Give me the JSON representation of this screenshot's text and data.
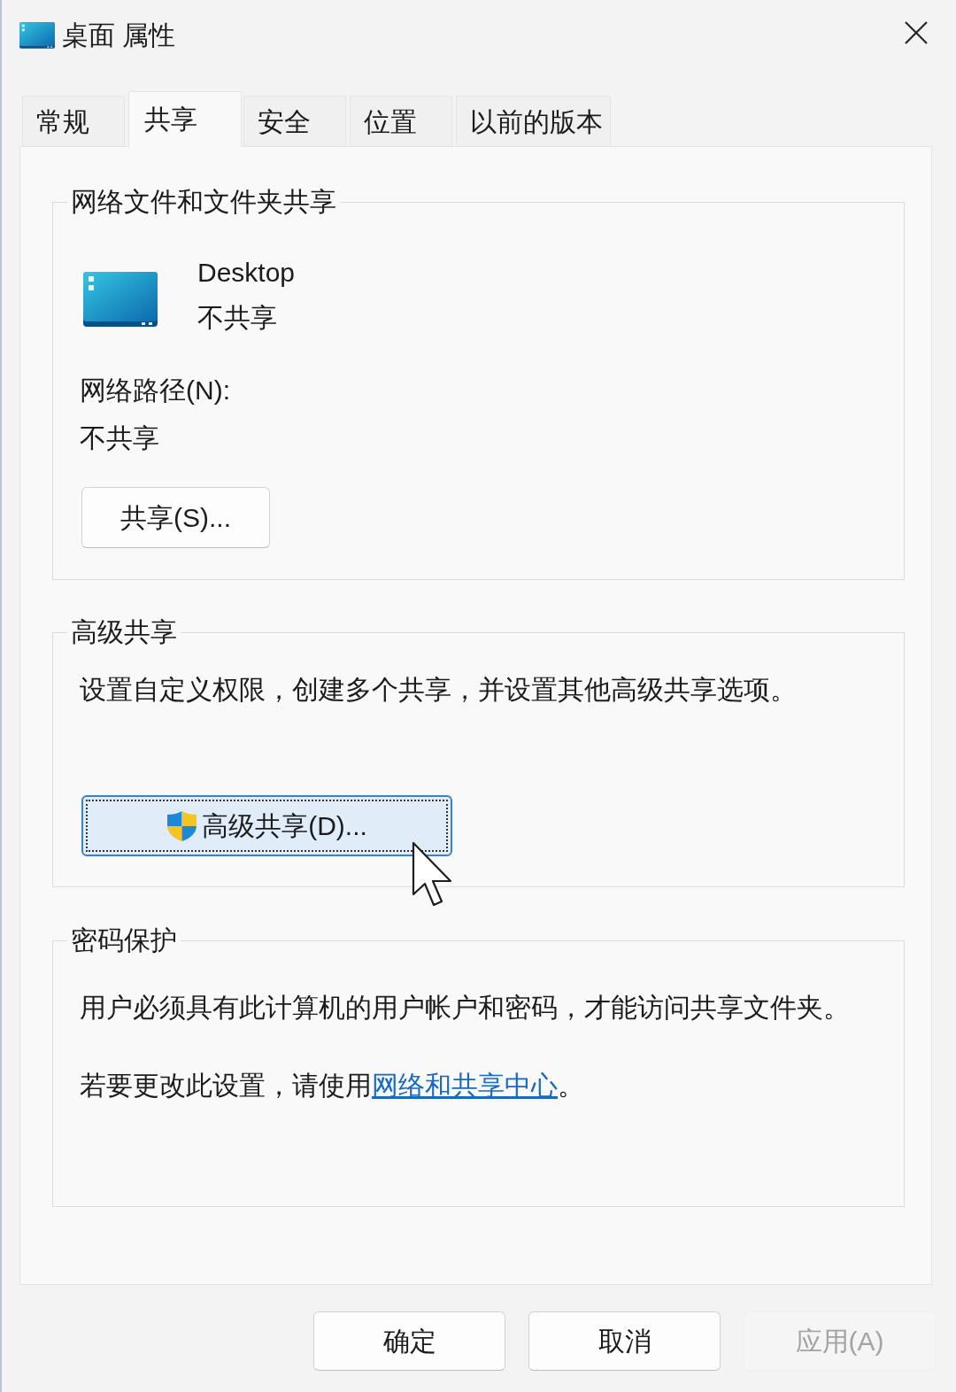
{
  "window": {
    "title": "桌面 属性"
  },
  "tabs": [
    {
      "label": "常规",
      "selected": false
    },
    {
      "label": "共享",
      "selected": true
    },
    {
      "label": "安全",
      "selected": false
    },
    {
      "label": "位置",
      "selected": false
    },
    {
      "label": "以前的版本",
      "selected": false
    }
  ],
  "network_sharing": {
    "title": "网络文件和文件夹共享",
    "folder_name": "Desktop",
    "folder_status": "不共享",
    "path_label": "网络路径(N):",
    "path_value": "不共享",
    "button": {
      "label": "共享(S)...",
      "focused": false
    }
  },
  "advanced_sharing": {
    "title": "高级共享",
    "description": "设置自定义权限，创建多个共享，并设置其他高级共享选项。",
    "button": {
      "label": "高级共享(D)...",
      "focused": true
    }
  },
  "password_protection": {
    "title": "密码保护",
    "description": "用户必须具有此计算机的用户帐户和密码，才能访问共享文件夹。",
    "note": "若要更改此设置，请使用",
    "link": "网络和共享中心",
    "note_end": "。"
  },
  "buttons": [
    {
      "label": "确定",
      "disabled": false
    },
    {
      "label": "取消",
      "disabled": false
    },
    {
      "label": "应用(A)",
      "disabled": true
    }
  ]
}
